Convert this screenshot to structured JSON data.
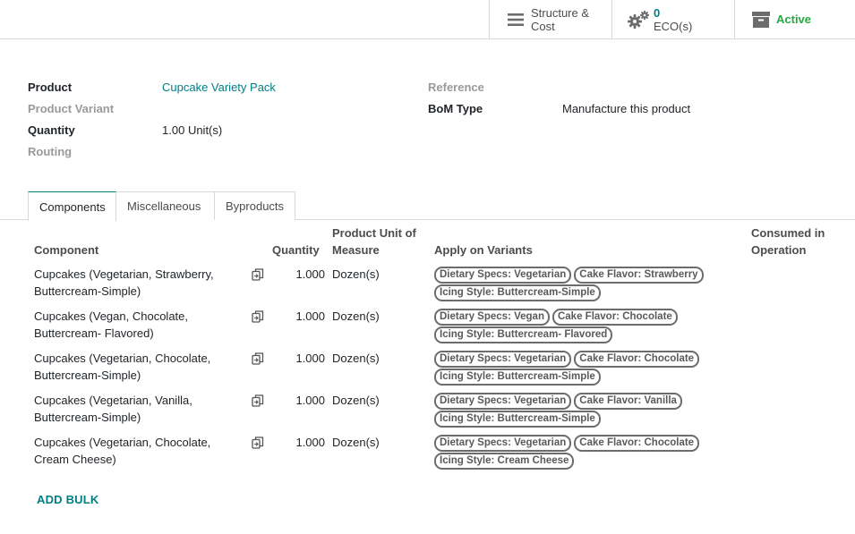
{
  "smart_buttons": {
    "structure": {
      "line1": "Structure &",
      "line2": "Cost",
      "icon": "bars-icon"
    },
    "eco": {
      "count": "0",
      "label": "ECO(s)",
      "icon": "gears-icon"
    },
    "active": {
      "label": "Active",
      "icon": "archive-icon"
    }
  },
  "form": {
    "product_label": "Product",
    "product_value": "Cupcake Variety Pack",
    "variant_label": "Product Variant",
    "quantity_label": "Quantity",
    "quantity_value": "1.00",
    "quantity_unit": "Unit(s)",
    "routing_label": "Routing",
    "reference_label": "Reference",
    "bom_type_label": "BoM Type",
    "bom_type_value": "Manufacture this product"
  },
  "tabs": [
    {
      "label": "Components",
      "active": true
    },
    {
      "label": "Miscellaneous",
      "active": false
    },
    {
      "label": "Byproducts",
      "active": false
    }
  ],
  "table": {
    "headers": {
      "component": "Component",
      "quantity": "Quantity",
      "uom_line1": "Product Unit of",
      "uom_line2": "Measure",
      "variants": "Apply on Variants",
      "consumed_line1": "Consumed in",
      "consumed_line2": "Operation"
    },
    "rows": [
      {
        "component_line1": "Cupcakes (Vegetarian, Strawberry,",
        "component_line2": "Buttercream-Simple)",
        "quantity": "1.000",
        "uom": "Dozen(s)",
        "tags": [
          "Dietary Specs: Vegetarian",
          "Cake Flavor: Strawberry",
          "Icing Style: Buttercream-Simple"
        ]
      },
      {
        "component_line1": "Cupcakes (Vegan, Chocolate,",
        "component_line2": "Buttercream- Flavored)",
        "quantity": "1.000",
        "uom": "Dozen(s)",
        "tags": [
          "Dietary Specs: Vegan",
          "Cake Flavor: Chocolate",
          "Icing Style: Buttercream- Flavored"
        ]
      },
      {
        "component_line1": "Cupcakes (Vegetarian, Chocolate,",
        "component_line2": "Buttercream-Simple)",
        "quantity": "1.000",
        "uom": "Dozen(s)",
        "tags": [
          "Dietary Specs: Vegetarian",
          "Cake Flavor: Chocolate",
          "Icing Style: Buttercream-Simple"
        ]
      },
      {
        "component_line1": "Cupcakes (Vegetarian, Vanilla,",
        "component_line2": "Buttercream-Simple)",
        "quantity": "1.000",
        "uom": "Dozen(s)",
        "tags": [
          "Dietary Specs: Vegetarian",
          "Cake Flavor: Vanilla",
          "Icing Style: Buttercream-Simple"
        ]
      },
      {
        "component_line1": "Cupcakes (Vegetarian, Chocolate,",
        "component_line2": "Cream Cheese)",
        "quantity": "1.000",
        "uom": "Dozen(s)",
        "tags": [
          "Dietary Specs: Vegetarian",
          "Cake Flavor: Chocolate",
          "Icing Style: Cream Cheese"
        ]
      }
    ]
  },
  "add_bulk_label": "ADD BULK",
  "colors": {
    "accent": "#017e84",
    "active": "#28a745"
  }
}
